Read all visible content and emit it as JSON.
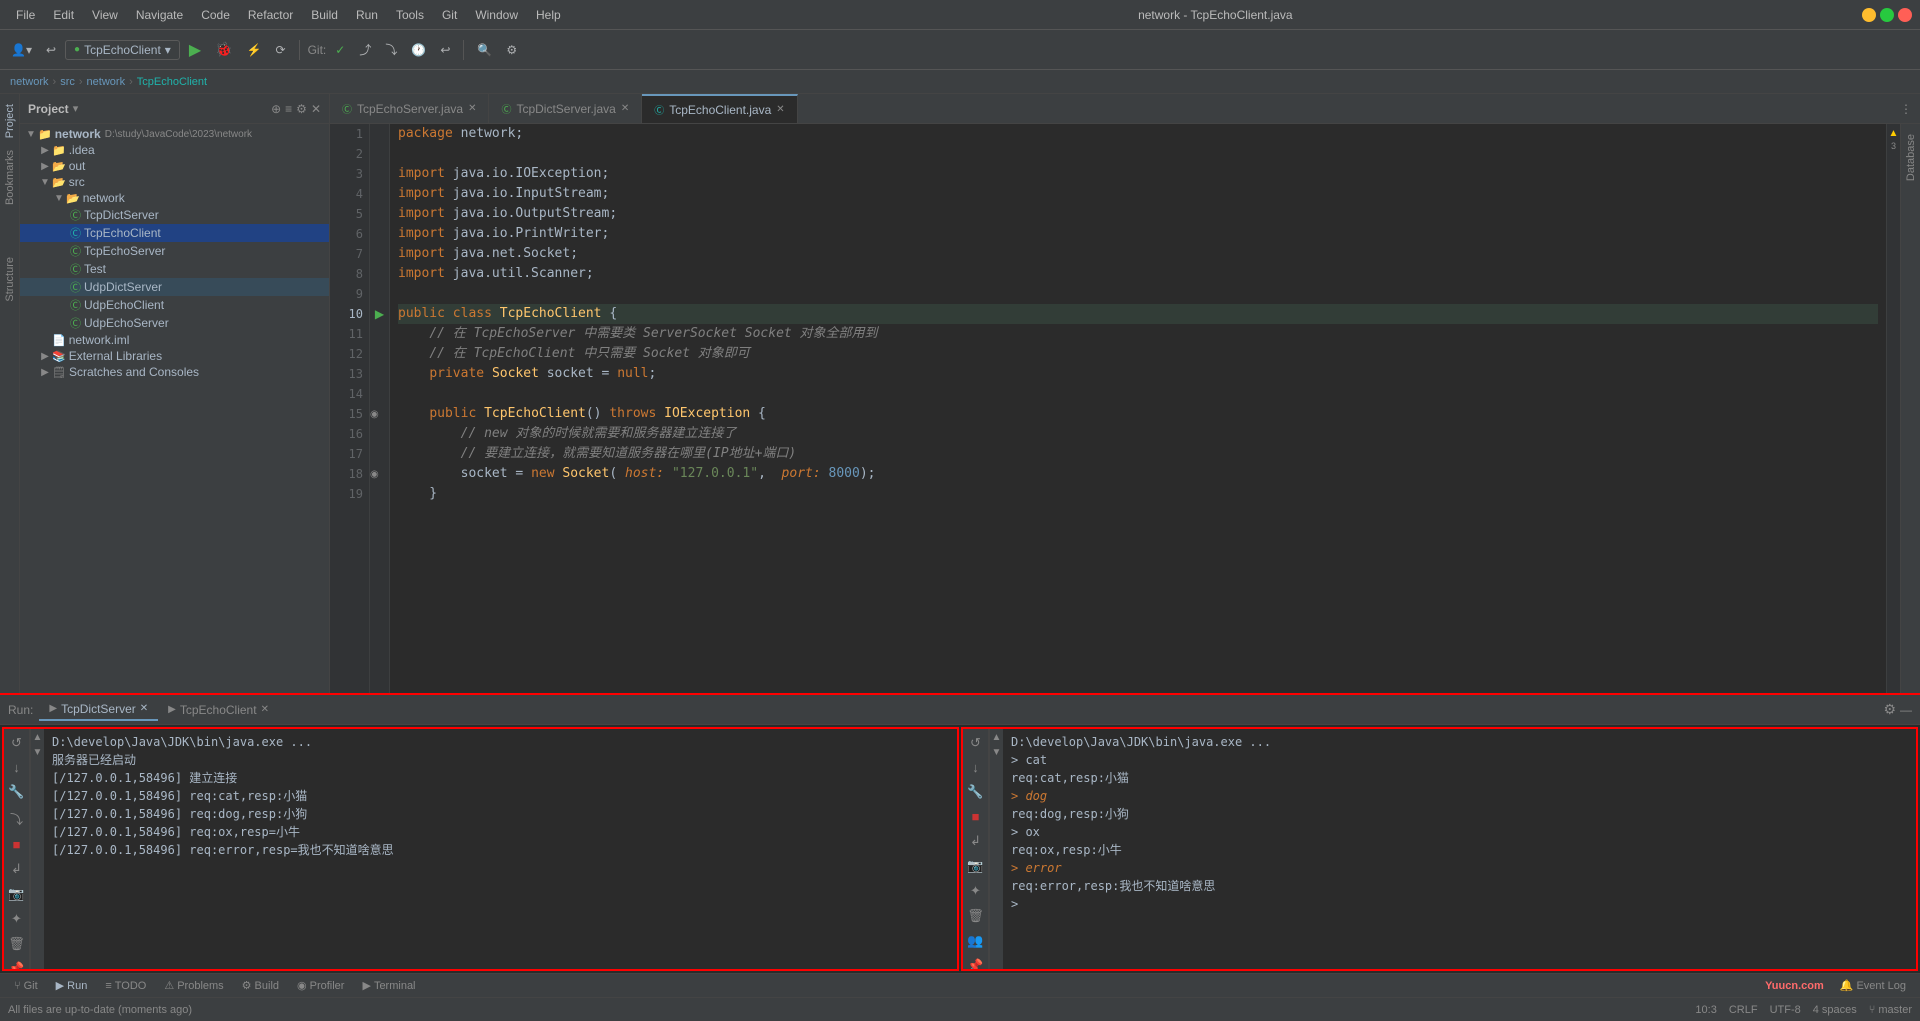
{
  "titlebar": {
    "title": "network - TcpEchoClient.java",
    "menus": [
      "File",
      "Edit",
      "View",
      "Navigate",
      "Code",
      "Refactor",
      "Build",
      "Run",
      "Tools",
      "Git",
      "Window",
      "Help"
    ]
  },
  "breadcrumb": {
    "items": [
      "network",
      "src",
      "network",
      "TcpEchoClient"
    ]
  },
  "project": {
    "title": "Project",
    "root": "network",
    "rootPath": "D:\\study\\JavaCode\\2023\\network",
    "items": [
      {
        "indent": 1,
        "type": "folder",
        "label": ".idea",
        "collapsed": true
      },
      {
        "indent": 1,
        "type": "folder-open",
        "label": "out",
        "collapsed": false
      },
      {
        "indent": 1,
        "type": "folder-open",
        "label": "src",
        "collapsed": false
      },
      {
        "indent": 2,
        "type": "folder-open",
        "label": "network",
        "collapsed": false
      },
      {
        "indent": 3,
        "type": "java",
        "label": "TcpDictServer"
      },
      {
        "indent": 3,
        "type": "java",
        "label": "TcpEchoClient",
        "selected": true
      },
      {
        "indent": 3,
        "type": "java",
        "label": "TcpEchoServer"
      },
      {
        "indent": 3,
        "type": "java",
        "label": "Test"
      },
      {
        "indent": 3,
        "type": "java",
        "label": "UdpDictServer",
        "highlighted": true
      },
      {
        "indent": 3,
        "type": "java",
        "label": "UdpEchoClient"
      },
      {
        "indent": 3,
        "type": "java",
        "label": "UdpEchoServer"
      },
      {
        "indent": 2,
        "type": "module",
        "label": "network.iml"
      },
      {
        "indent": 1,
        "type": "folder",
        "label": "External Libraries",
        "collapsed": true
      },
      {
        "indent": 1,
        "type": "folder",
        "label": "Scratches and Consoles",
        "collapsed": true
      }
    ]
  },
  "tabs": [
    {
      "label": "TcpEchoServer.java",
      "icon": "green",
      "active": false
    },
    {
      "label": "TcpDictServer.java",
      "icon": "green",
      "active": false
    },
    {
      "label": "TcpEchoClient.java",
      "icon": "teal",
      "active": true
    }
  ],
  "editor": {
    "lines": [
      {
        "num": 1,
        "code": "package network;",
        "highlight": false
      },
      {
        "num": 2,
        "code": "",
        "highlight": false
      },
      {
        "num": 3,
        "code": "import java.io.IOException;",
        "highlight": false
      },
      {
        "num": 4,
        "code": "import java.io.InputStream;",
        "highlight": false
      },
      {
        "num": 5,
        "code": "import java.io.OutputStream;",
        "highlight": false
      },
      {
        "num": 6,
        "code": "import java.io.PrintWriter;",
        "highlight": false
      },
      {
        "num": 7,
        "code": "import java.net.Socket;",
        "highlight": false
      },
      {
        "num": 8,
        "code": "import java.util.Scanner;",
        "highlight": false
      },
      {
        "num": 9,
        "code": "",
        "highlight": false
      },
      {
        "num": 10,
        "code": "public class TcpEchoClient {",
        "highlight": true
      },
      {
        "num": 11,
        "code": "    // 在 TcpEchoServer 中需要类 ServerSocket Socket 对象全部用到",
        "highlight": false
      },
      {
        "num": 12,
        "code": "    // 在 TcpEchoClient 中只需要 Socket 对象即可",
        "highlight": false
      },
      {
        "num": 13,
        "code": "    private Socket socket = null;",
        "highlight": false
      },
      {
        "num": 14,
        "code": "",
        "highlight": false
      },
      {
        "num": 15,
        "code": "    public TcpEchoClient() throws IOException {",
        "highlight": false
      },
      {
        "num": 16,
        "code": "        // new 对象的时候就需要和服务器建立连接了",
        "highlight": false
      },
      {
        "num": 17,
        "code": "        // 要建立连接，就需要知道服务器在哪里(IP地址+端口)",
        "highlight": false
      },
      {
        "num": 18,
        "code": "        socket = new Socket( host: \"127.0.0.1\",  port: 8000);",
        "highlight": false
      },
      {
        "num": 19,
        "code": "    }",
        "highlight": false
      }
    ]
  },
  "run_panels": {
    "left": {
      "title": "TcpDictServer",
      "lines": [
        "D:\\develop\\Java\\JDK\\bin\\java.exe ...",
        "服务器已经启动",
        "[/127.0.0.1,58496] 建立连接",
        "[/127.0.0.1,58496] req:cat,resp:小猫",
        "[/127.0.0.1,58496] req:dog,resp:小狗",
        "[/127.0.0.1,58496] req:ox,resp=小牛",
        "[/127.0.0.1,58496] req:error,resp=我也不知道啥意思"
      ]
    },
    "right": {
      "title": "TcpEchoClient",
      "lines": [
        {
          "text": "D:\\develop\\Java\\JDK\\bin\\java.exe ...",
          "style": "normal"
        },
        {
          "text": "> cat",
          "style": "normal"
        },
        {
          "text": "req:cat,resp:小猫",
          "style": "normal"
        },
        {
          "text": "> dog",
          "style": "italic"
        },
        {
          "text": "req:dog,resp:小狗",
          "style": "normal"
        },
        {
          "text": "> ox",
          "style": "normal"
        },
        {
          "text": "req:ox,resp:小牛",
          "style": "normal"
        },
        {
          "text": "> error",
          "style": "italic"
        },
        {
          "text": "req:error,resp:我也不知道啥意思",
          "style": "normal"
        },
        {
          "text": ">",
          "style": "normal"
        }
      ]
    }
  },
  "bottom_toolbar": {
    "items": [
      {
        "icon": "▶",
        "label": "Git"
      },
      {
        "icon": "▶",
        "label": "Run",
        "active": true
      },
      {
        "icon": "≡",
        "label": "TODO"
      },
      {
        "icon": "!",
        "label": "Problems"
      },
      {
        "icon": "⚙",
        "label": "Build"
      },
      {
        "icon": "◉",
        "label": "Profiler"
      },
      {
        "icon": "▶",
        "label": "Terminal"
      },
      {
        "icon": "📋",
        "label": "Event Log",
        "right": true
      }
    ]
  },
  "status_bar": {
    "message": "All files are up-to-date (moments ago)",
    "position": "10:3",
    "crlf": "CRLF",
    "encoding": "UTF-8",
    "indent": "4 spaces",
    "branch": "master",
    "yuucn": "Yuucn.com"
  },
  "run_config": "TcpEchoClient"
}
